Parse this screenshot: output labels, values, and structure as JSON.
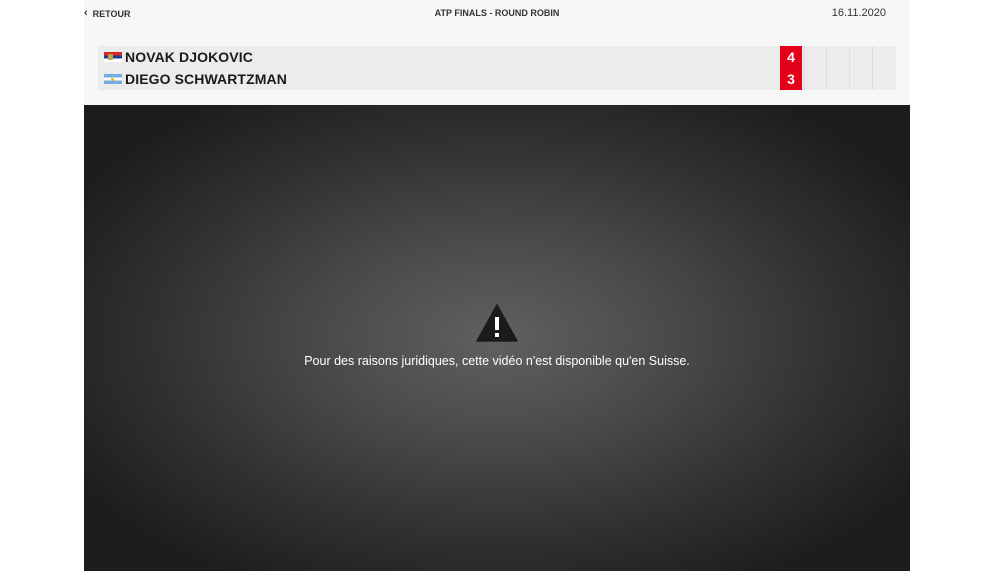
{
  "header": {
    "back_label": "RETOUR",
    "back_icon": "chevron-left-icon",
    "event_title": "ATP FINALS - ROUND ROBIN",
    "date": "16.11.2020"
  },
  "match": {
    "players": [
      {
        "name": "NOVAK DJOKOVIC",
        "flag": "serbia-flag-icon",
        "score": "4"
      },
      {
        "name": "DIEGO SCHWARTZMAN",
        "flag": "argentina-flag-icon",
        "score": "3"
      }
    ],
    "score_color": "#e2001a"
  },
  "video": {
    "icon": "warning-icon",
    "message": "Pour des raisons juridiques, cette vidéo n'est disponible qu'en Suisse."
  }
}
